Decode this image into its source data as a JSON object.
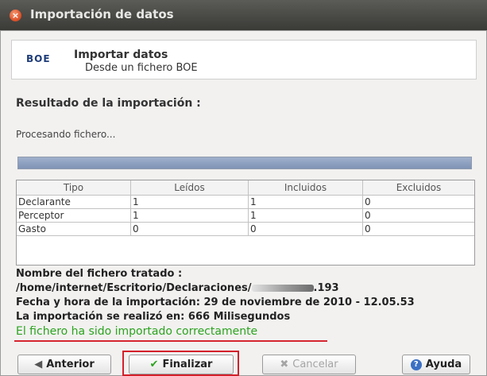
{
  "window": {
    "title": "Importación de datos",
    "close_glyph": "×"
  },
  "header": {
    "logo_text": "BOE",
    "title": "Importar datos",
    "subtitle": "Desde un fichero BOE"
  },
  "result_label": "Resultado de la importación :",
  "processing_label": "Procesando fichero...",
  "progress": {
    "percent": 100,
    "color": "#8a9cbd"
  },
  "table": {
    "columns": [
      "Tipo",
      "Leídos",
      "Incluidos",
      "Excluidos"
    ],
    "rows": [
      [
        "Declarante",
        "1",
        "1",
        "0"
      ],
      [
        "Perceptor",
        "1",
        "1",
        "0"
      ],
      [
        "Gasto",
        "0",
        "0",
        "0"
      ]
    ]
  },
  "info": {
    "file_label": "Nombre del fichero tratado :",
    "file_path_start": "/home/internet/Escritorio/Declaraciones/",
    "file_path_end": ".193",
    "date_line": "Fecha y hora de la importación: 29 de noviembre de 2010 - 12.05.53",
    "duration_line": "La importación se realizó en: 666 Milisegundos",
    "success_message": "El fichero ha sido importado correctamente"
  },
  "buttons": {
    "previous": {
      "label": "Anterior",
      "icon": "◀"
    },
    "finish": {
      "label": "Finalizar",
      "icon": "✔"
    },
    "cancel": {
      "label": "Cancelar",
      "icon": "✖"
    },
    "help": {
      "label": "Ayuda",
      "icon": "?"
    }
  },
  "colors": {
    "success": "#2ca31f",
    "annotation_red": "#d3202a"
  }
}
